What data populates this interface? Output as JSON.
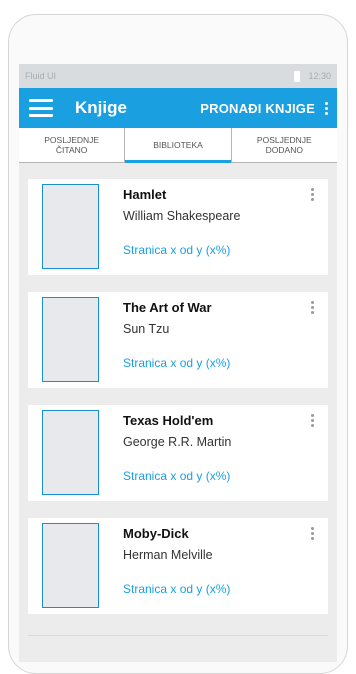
{
  "status": {
    "app_name": "Fluid UI",
    "time": "12:30"
  },
  "appbar": {
    "title": "Knjige",
    "action_label": "PRONAĐI KNJIGE"
  },
  "tabs": [
    {
      "label": "POSLJEDNJE ČITANO",
      "active": false
    },
    {
      "label": "BIBLIOTEKA",
      "active": true
    },
    {
      "label": "POSLJEDNJE DODANO",
      "active": false
    }
  ],
  "books": [
    {
      "title": "Hamlet",
      "author": "William Shakespeare",
      "progress": "Stranica x od y (x%)"
    },
    {
      "title": "The Art of War",
      "author": "Sun Tzu",
      "progress": "Stranica x od y (x%)"
    },
    {
      "title": "Texas Hold'em",
      "author": "George R.R. Martin",
      "progress": "Stranica x od y (x%)"
    },
    {
      "title": "Moby-Dick",
      "author": "Herman Melville",
      "progress": "Stranica x od y (x%)"
    }
  ],
  "colors": {
    "primary": "#1aa0e1",
    "status_bar": "#d9dcdf",
    "background": "#ececec"
  },
  "icons": {
    "menu": "hamburger-icon",
    "overflow": "more-vertical-icon",
    "battery": "battery-icon"
  }
}
